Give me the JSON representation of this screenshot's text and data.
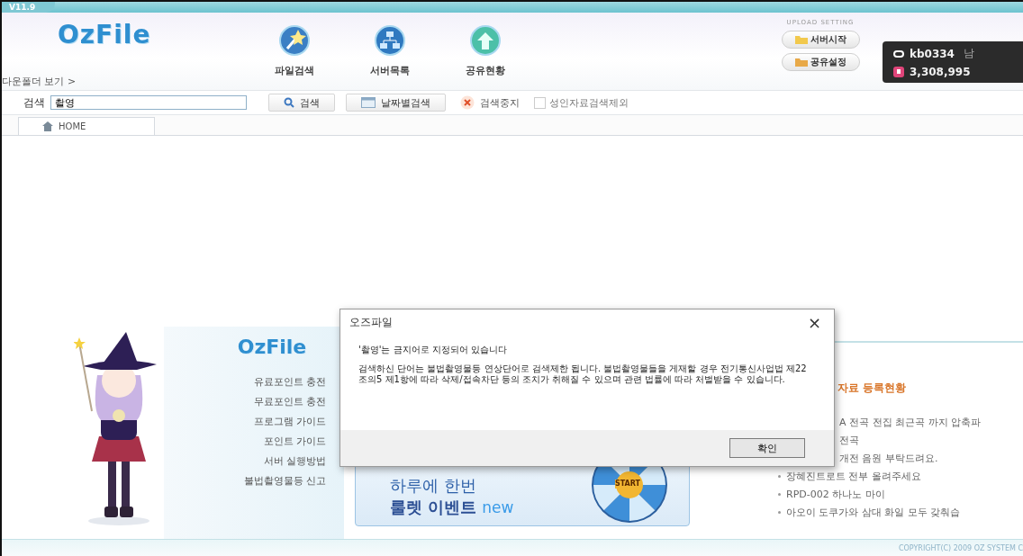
{
  "version": "V11.9",
  "logo": "OzFile",
  "download_folder_link": "다운폴더 보기 >",
  "nav": [
    {
      "label": "파일검색",
      "kind": "wand"
    },
    {
      "label": "서버목록",
      "kind": "network"
    },
    {
      "label": "공유현황",
      "kind": "share"
    }
  ],
  "upload_setting": {
    "title": "UPLOAD SETTING",
    "buttons": [
      {
        "label": "서버시작",
        "kind": "folder"
      },
      {
        "label": "공유설정",
        "kind": "open-folder"
      }
    ]
  },
  "user": {
    "id": "kb0334",
    "extra": "남",
    "points": "3,308,995"
  },
  "search": {
    "label": "검색",
    "value": "촬영",
    "buttons": [
      {
        "label": "검색",
        "kind": "search"
      },
      {
        "label": "날짜별검색",
        "kind": "calendar"
      },
      {
        "label": "검색중지",
        "kind": "stop"
      }
    ],
    "adult_filter": {
      "label": "성인자료검색제외",
      "checked": false
    }
  },
  "tabs": [
    {
      "label": "HOME",
      "selected": true
    }
  ],
  "home": {
    "logo": "OzFile",
    "menu": [
      "유료포인트 충전",
      "무료포인트 충전",
      "프로그램 가이드",
      "포인트 가이드",
      "서버 실행방법",
      "불법촬영물등 신고"
    ],
    "banner": {
      "line1": "하루에 한번",
      "line2": "룰렛 이벤트",
      "badge": "new",
      "wheel_label": "START"
    },
    "uploads": {
      "title": "자료 등록현황",
      "items": [
        {
          "text": "A 전곡 전집 최근곡 까지 압축파",
          "kind": "covered"
        },
        {
          "text": "전곡",
          "kind": "covered"
        },
        {
          "text": "개전 음원 부탁드려요.",
          "kind": "covered"
        },
        {
          "text": "장혜진트로트 전부 올려주세요",
          "kind": "full"
        },
        {
          "text": "RPD-002 하나노 마이",
          "kind": "full"
        },
        {
          "text": "아오이 도쿠가와 삼대 화일 모두 갖춰습",
          "kind": "full"
        }
      ]
    },
    "copyright": "COPYRIGHT(C) 2009 OZ SYSTEM C"
  },
  "dialog": {
    "title": "오즈파일",
    "close": "×",
    "heading": "'촬영'는 금지어로 지정되어 있습니다",
    "message": "검색하신 단어는 불법촬영물등 연상단어로 검색제한 됩니다. 불법촬영물들을 게재할 경우 전기통신사업법 제22조의5 제1항에 따라 삭제/접속차단 등의 조치가 취해질 수 있으며 관련 법률에 따라 처벌받을 수 있습니다.",
    "ok": "확인"
  }
}
